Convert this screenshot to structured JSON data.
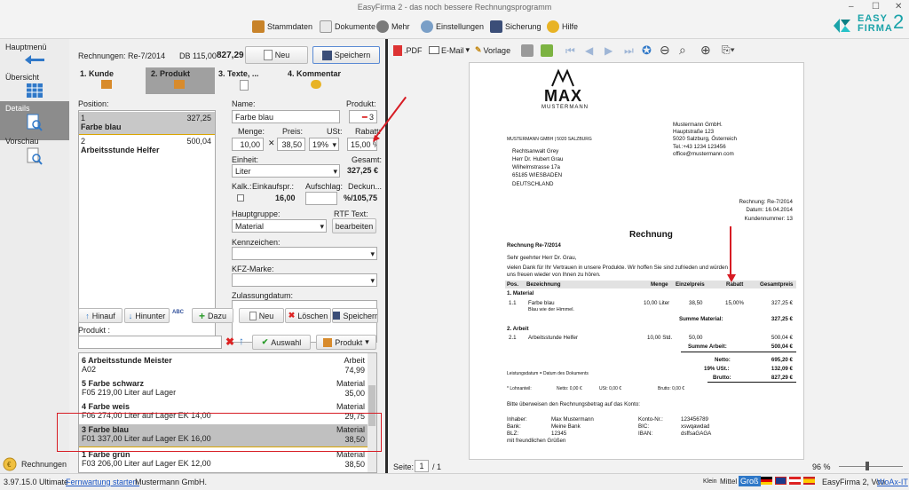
{
  "window": {
    "title": "EasyFirma 2 - das noch bessere Rechnungsprogramm",
    "min": "–",
    "max": "☐",
    "close": "✕"
  },
  "menu": [
    "Stammdaten",
    "Dokumente",
    "Mehr",
    "Einstellungen",
    "Sicherung",
    "Hilfe"
  ],
  "logo": {
    "line1": "EASY",
    "line2": "FIRMA",
    "num": "2"
  },
  "nav": {
    "main": "Hauptmenü",
    "overview": "Übersicht",
    "details": "Details",
    "preview": "Vorschau",
    "invoices": "Rechnungen"
  },
  "header": {
    "invoice": "Rechnungen: Re-7/2014",
    "db_label": "DB 115,00",
    "db_value": "827,29",
    "new": "Neu",
    "save": "Speichern"
  },
  "tabs": [
    "1. Kunde",
    "2. Produkt",
    "3. Texte, ...",
    "4. Kommentar"
  ],
  "positions": {
    "label": "Position:",
    "items": [
      {
        "num": "1",
        "amount": "327,25",
        "name": "Farbe blau"
      },
      {
        "num": "2",
        "amount": "500,04",
        "name": "Arbeitsstunde Helfer"
      }
    ]
  },
  "form": {
    "name_label": "Name:",
    "name": "Farbe blau",
    "product_label": "Produkt:",
    "product": "3",
    "qty_label": "Menge:",
    "qty": "10,00",
    "price_label": "Preis:",
    "price": "38,50",
    "vat_label": "USt:",
    "vat": "19%",
    "discount_label": "Rabatt:",
    "discount": "15,00 %",
    "unit_label": "Einheit:",
    "unit": "Liter",
    "total_label": "Gesamt:",
    "total": "327,25 €",
    "calc_label": "Kalk.:",
    "purchase_label": "Einkaufspr.:",
    "purchase": "16,00",
    "markup_label": "Aufschlag:",
    "coverage_label": "Deckun...",
    "coverage": "%/105,75",
    "group_label": "Hauptgruppe:",
    "group": "Material",
    "rtf_label": "RTF Text:",
    "rtf_btn": "bearbeiten",
    "mark_label": "Kennzeichen:",
    "kfz_label": "KFZ-Marke:",
    "reg_label": "Zulassungdatum:"
  },
  "actions": {
    "up": "Hinauf",
    "down": "Hinunter",
    "abc": "ABC",
    "add": "Dazu",
    "new": "Neu",
    "delete": "Löschen",
    "save": "Speicherr"
  },
  "product_search": {
    "label": "Produkt :",
    "select": "Auswahl",
    "product": "Produkt"
  },
  "products": [
    {
      "title": "6 Arbeitsstunde Meister",
      "cat": "Arbeit",
      "sub": "A02",
      "price": "74,99"
    },
    {
      "title": "5 Farbe schwarz",
      "cat": "Material",
      "sub": "F05 219,00 Liter auf Lager",
      "price": "35,00"
    },
    {
      "title": "4 Farbe weis",
      "cat": "Material",
      "sub": "F06 274,00 Liter auf Lager EK 14,00",
      "price": "29,75"
    },
    {
      "title": "3 Farbe blau",
      "cat": "Material",
      "sub": "F01 337,00 Liter auf Lager EK 16,00",
      "price": "38,50"
    },
    {
      "title": "1 Farbe grün",
      "cat": "Material",
      "sub": "F03 206,00 Liter auf Lager EK 12,00",
      "price": "38,50"
    }
  ],
  "preview_toolbar": {
    "pdf": ".PDF",
    "email": "E-Mail",
    "template": "Vorlage"
  },
  "doc": {
    "brand": "MAX",
    "brand_sub": "MUSTERMANN",
    "sender_line": "MUSTERMANN GMBH | 5020 SALZBURG",
    "company": [
      "Mustermann GmbH.",
      "Hauptstraße 123",
      "5020 Salzburg, Österreich",
      "Tel.:+43 1234 123456",
      "office@mustermann.com"
    ],
    "recipient": [
      "Rechtsanwalt Grey",
      "Herr Dr. Hubert Grau",
      "Wilhelmstrasse 17a",
      "65185 WIESBADEN",
      "DEUTSCHLAND"
    ],
    "meta": [
      "Rechnung: Re-7/2014",
      "Datum: 16.04.2014",
      "Kundennummer: 13"
    ],
    "heading": "Rechnung",
    "subject": "Rechnung Re-7/2014",
    "greeting": "Sehr geehrter Herr Dr. Grau,",
    "intro1": "vielen Dank für Ihr Vertrauen in unsere Produkte. Wir hoffen Sie sind zufrieden und würden",
    "intro2": "uns freuen wieder von Ihnen zu hören.",
    "cols": [
      "Pos.",
      "Bezeichnung",
      "Menge",
      "Einzelpreis",
      "Rabatt",
      "Gesamtpreis"
    ],
    "sec1": "1. Material",
    "row1": {
      "pos": "1.1",
      "name": "Farbe blau",
      "qty": "10,00 Liter",
      "price": "38,50",
      "disc": "15,00%",
      "total": "327,25 €",
      "note": "Blau wie der Himmel."
    },
    "sum1_label": "Summe Material:",
    "sum1": "327,25 €",
    "sec2": "2. Arbeit",
    "row2": {
      "pos": "2.1",
      "name": "Arbeitsstunde Helfer",
      "qty": "10,00 Std.",
      "price": "50,00",
      "total": "500,04 €"
    },
    "sum2_label": "Summe Arbeit:",
    "sum2": "500,04 €",
    "net_label": "Netto:",
    "net": "695,20 €",
    "vat_label": "19% USt.:",
    "vat": "132,09 €",
    "gross_label": "Brutto:",
    "gross": "827,29 €",
    "perf_note": "Leistungsdatum = Datum des Dokuments",
    "adv": "* Lohnanteil:",
    "adv_net": "Netto: 0,00 €",
    "adv_vat": "USt: 0,00 €",
    "adv_gross": "Brutto: 0,00 €",
    "pay": "Bitte überweisen den Rechnungsbetrag auf das Konto:",
    "bank_left": [
      "Inhaber:",
      "Bank:",
      "BLZ:"
    ],
    "bank_left_v": [
      "Max Mustermann",
      "Meine Bank",
      "12345"
    ],
    "bank_right": [
      "Konto-Nr.:",
      "BIC:",
      "IBAN:"
    ],
    "bank_right_v": [
      "123456789",
      "xswqawdad",
      "dsffsaGAGA"
    ],
    "closing": "mit freundlichen Grüßen"
  },
  "pager": {
    "label": "Seite:",
    "page": "1",
    "of": "/ 1"
  },
  "zoom": "96 %",
  "status": {
    "version": "3.97.15.0 Ultimate",
    "remote": "Fernwartung starten.",
    "company": "Mustermann GmbH.",
    "small": "Klein",
    "medium": "Mittel",
    "large": "Groß",
    "credit": "EasyFirma 2, Von",
    "author": "WoAx-IT"
  }
}
